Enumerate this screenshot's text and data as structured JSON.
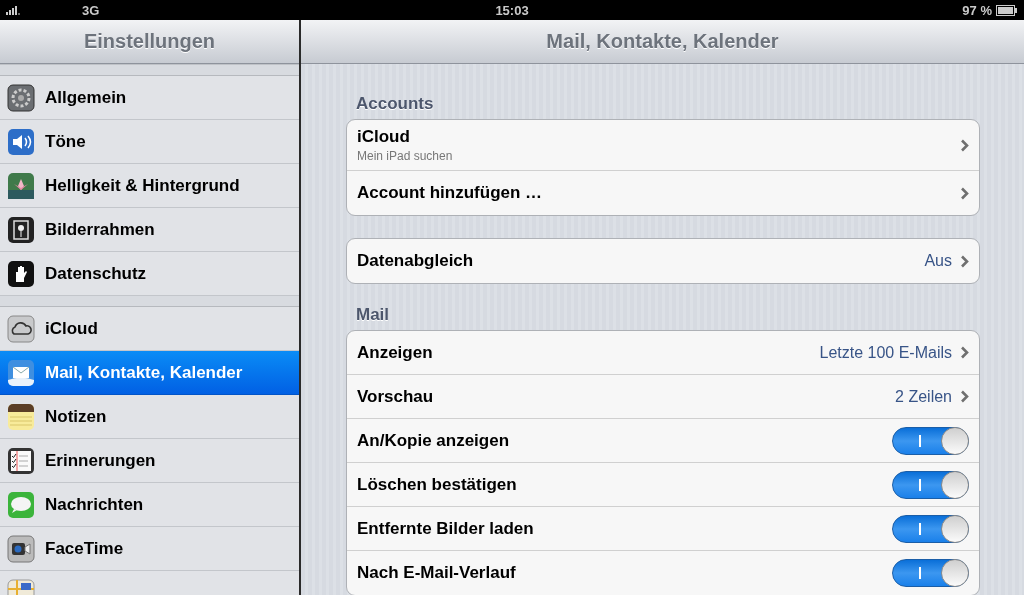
{
  "status_bar": {
    "network": "3G",
    "time": "15:03",
    "battery": "97 %"
  },
  "sidebar": {
    "title": "Einstellungen",
    "groups": [
      [
        {
          "label": "Allgemein",
          "selected": false
        },
        {
          "label": "Töne",
          "selected": false
        },
        {
          "label": "Helligkeit & Hintergrund",
          "selected": false
        },
        {
          "label": "Bilderrahmen",
          "selected": false
        },
        {
          "label": "Datenschutz",
          "selected": false
        }
      ],
      [
        {
          "label": "iCloud",
          "selected": false
        },
        {
          "label": "Mail, Kontakte, Kalender",
          "selected": true
        },
        {
          "label": "Notizen",
          "selected": false
        },
        {
          "label": "Erinnerungen",
          "selected": false
        },
        {
          "label": "Nachrichten",
          "selected": false
        },
        {
          "label": "FaceTime",
          "selected": false
        }
      ]
    ]
  },
  "detail": {
    "title": "Mail, Kontakte, Kalender",
    "sections": [
      {
        "header": "Accounts",
        "rows": [
          {
            "kind": "link",
            "label": "iCloud",
            "subtitle": "Mein iPad suchen"
          },
          {
            "kind": "link",
            "label": "Account hinzufügen …"
          }
        ]
      },
      {
        "rows": [
          {
            "kind": "link",
            "label": "Datenabgleich",
            "value": "Aus"
          }
        ]
      },
      {
        "header": "Mail",
        "rows": [
          {
            "kind": "link",
            "label": "Anzeigen",
            "value": "Letzte 100 E-Mails"
          },
          {
            "kind": "link",
            "label": "Vorschau",
            "value": "2 Zeilen"
          },
          {
            "kind": "switch",
            "label": "An/Kopie anzeigen",
            "on": true
          },
          {
            "kind": "switch",
            "label": "Löschen bestätigen",
            "on": true
          },
          {
            "kind": "switch",
            "label": "Entfernte Bilder laden",
            "on": true
          },
          {
            "kind": "switch",
            "label": "Nach E-Mail-Verlauf",
            "on": true
          }
        ]
      }
    ]
  }
}
